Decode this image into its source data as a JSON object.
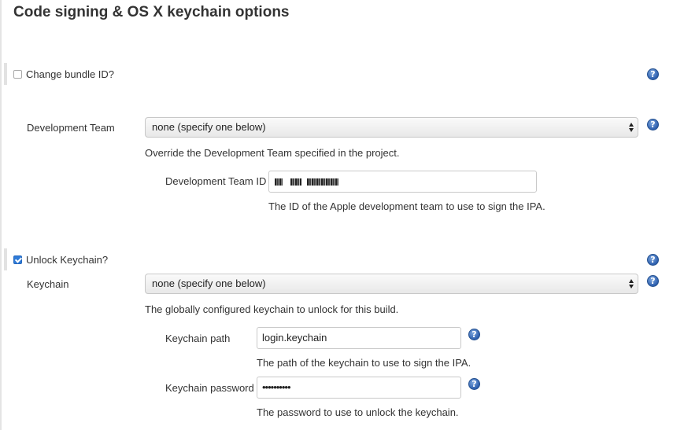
{
  "section": {
    "title": "Code signing & OS X keychain options"
  },
  "change_bundle": {
    "label": "Change bundle ID?",
    "checked": false,
    "help_icon": "help-icon"
  },
  "development_team": {
    "label": "Development Team",
    "selected": "none (specify one below)",
    "description": "Override the Development Team specified in the project.",
    "team_id_label": "Development Team ID",
    "team_id_value_obscured": true,
    "team_id_description": "The ID of the Apple development team to use to sign the IPA."
  },
  "unlock_keychain": {
    "label": "Unlock Keychain?",
    "checked": true
  },
  "keychain": {
    "label": "Keychain",
    "selected": "none (specify one below)",
    "description": "The globally configured keychain to unlock for this build.",
    "path_label": "Keychain path",
    "path_value": "login.keychain",
    "path_description": "The path of the keychain to use to sign the IPA.",
    "password_label": "Keychain password",
    "password_value": "••••••••••",
    "password_description": "The password to use to unlock the keychain."
  },
  "colors": {
    "help_blue": "#2d5fae",
    "checkbox_blue": "#2f7bd8"
  }
}
